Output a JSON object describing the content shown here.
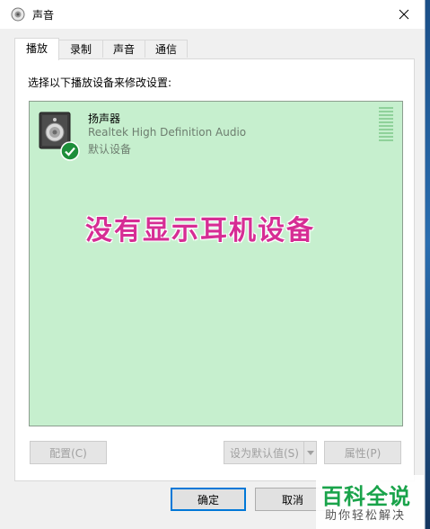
{
  "window": {
    "title": "声音"
  },
  "tabs": [
    {
      "label": "播放"
    },
    {
      "label": "录制"
    },
    {
      "label": "声音"
    },
    {
      "label": "通信"
    }
  ],
  "instruction": "选择以下播放设备来修改设置:",
  "device": {
    "name": "扬声器",
    "driver": "Realtek High Definition Audio",
    "status": "默认设备"
  },
  "overlay_caption": "没有显示耳机设备",
  "buttons": {
    "configure": "配置(C)",
    "set_default": "设为默认值(S)",
    "properties": "属性(P)",
    "ok": "确定",
    "cancel": "取消"
  },
  "watermark": {
    "title": "百科全说",
    "subtitle": "助你轻松解决"
  },
  "colors": {
    "accent": "#0078d7",
    "list_selected_bg": "#c6efce",
    "overlay_text": "#d62d94",
    "watermark_green": "#19a34a"
  }
}
